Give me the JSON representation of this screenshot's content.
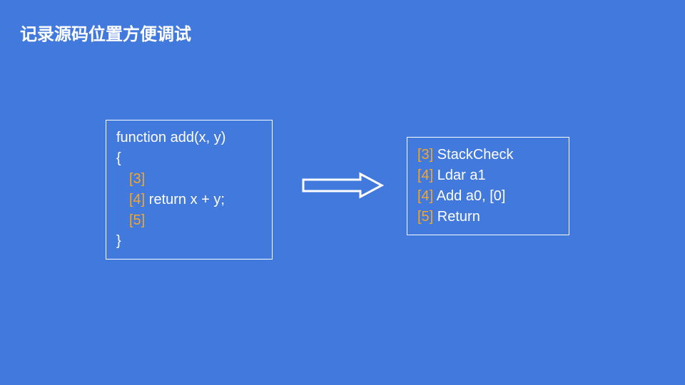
{
  "title": "记录源码位置方便调试",
  "source": {
    "line1": "function add(x, y)",
    "line2": "{",
    "tag3": "[3]",
    "tag4": "[4]",
    "line4text": " return x + y;",
    "tag5": "[5]",
    "line6": "}"
  },
  "bytecode": {
    "l1": {
      "tag": "[3]",
      "text": " StackCheck"
    },
    "l2": {
      "tag": "[4]",
      "text": " Ldar a1"
    },
    "l3": {
      "tag": "[4]",
      "text": " Add a0, [0]"
    },
    "l4": {
      "tag": "[5]",
      "text": " Return"
    }
  }
}
